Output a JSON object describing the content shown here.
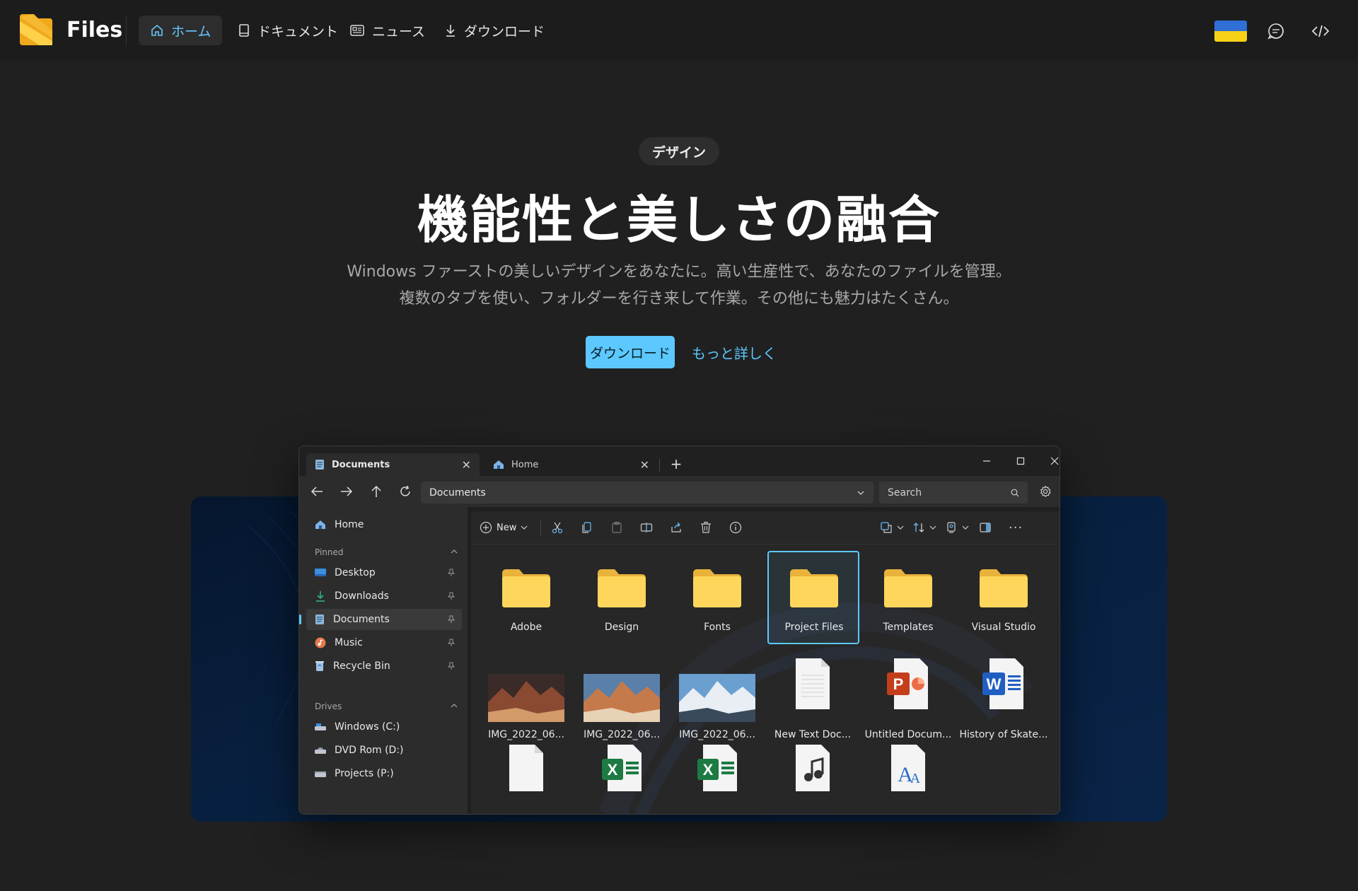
{
  "app": {
    "name": "Files"
  },
  "nav": {
    "items": [
      {
        "label": "ホーム",
        "icon": "home-icon",
        "active": true
      },
      {
        "label": "ドキュメント",
        "icon": "book-icon",
        "active": false
      },
      {
        "label": "ニュース",
        "icon": "news-icon",
        "active": false
      },
      {
        "label": "ダウンロード",
        "icon": "download-icon",
        "active": false
      }
    ],
    "right_icons": [
      "ukraine-flag-icon",
      "chat-icon",
      "code-icon"
    ]
  },
  "hero": {
    "badge": "デザイン",
    "title": "機能性と美しさの融合",
    "subtitle_line1": "Windows ファーストの美しいデザインをあなたに。高い生産性で、あなたのファイルを管理。",
    "subtitle_line2": "複数のタブを使い、フォルダーを行き来して作業。その他にも魅力はたくさん。",
    "primary_button": "ダウンロード",
    "secondary_link": "もっと詳しく"
  },
  "colors": {
    "accent": "#5cc8ff",
    "background": "#202020",
    "folder": "#f6c94d"
  },
  "window": {
    "tabs": [
      {
        "label": "Documents",
        "icon": "documents-icon",
        "active": true
      },
      {
        "label": "Home",
        "icon": "home-icon",
        "active": false
      }
    ],
    "address": "Documents",
    "search_placeholder": "Search",
    "toolbar": {
      "new_label": "New"
    },
    "sidebar": {
      "home": "Home",
      "pinned_header": "Pinned",
      "pinned": [
        {
          "label": "Desktop",
          "icon": "desktop-icon"
        },
        {
          "label": "Downloads",
          "icon": "download-icon"
        },
        {
          "label": "Documents",
          "icon": "documents-icon",
          "selected": true
        },
        {
          "label": "Music",
          "icon": "music-icon"
        },
        {
          "label": "Recycle Bin",
          "icon": "recycle-bin-icon"
        }
      ],
      "drives_header": "Drives",
      "drives": [
        {
          "label": "Windows (C:)",
          "icon": "drive-icon"
        },
        {
          "label": "DVD Rom (D:)",
          "icon": "dvd-icon"
        },
        {
          "label": "Projects (P:)",
          "icon": "drive-icon"
        }
      ]
    },
    "folders": [
      "Adobe",
      "Design",
      "Fonts",
      "Project Files",
      "Templates",
      "Visual Studio"
    ],
    "files": [
      "IMG_2022_06...",
      "IMG_2022_06...",
      "IMG_2022_06...",
      "New Text Doc...",
      "Untitled Docum...",
      "History of Skate..."
    ]
  }
}
